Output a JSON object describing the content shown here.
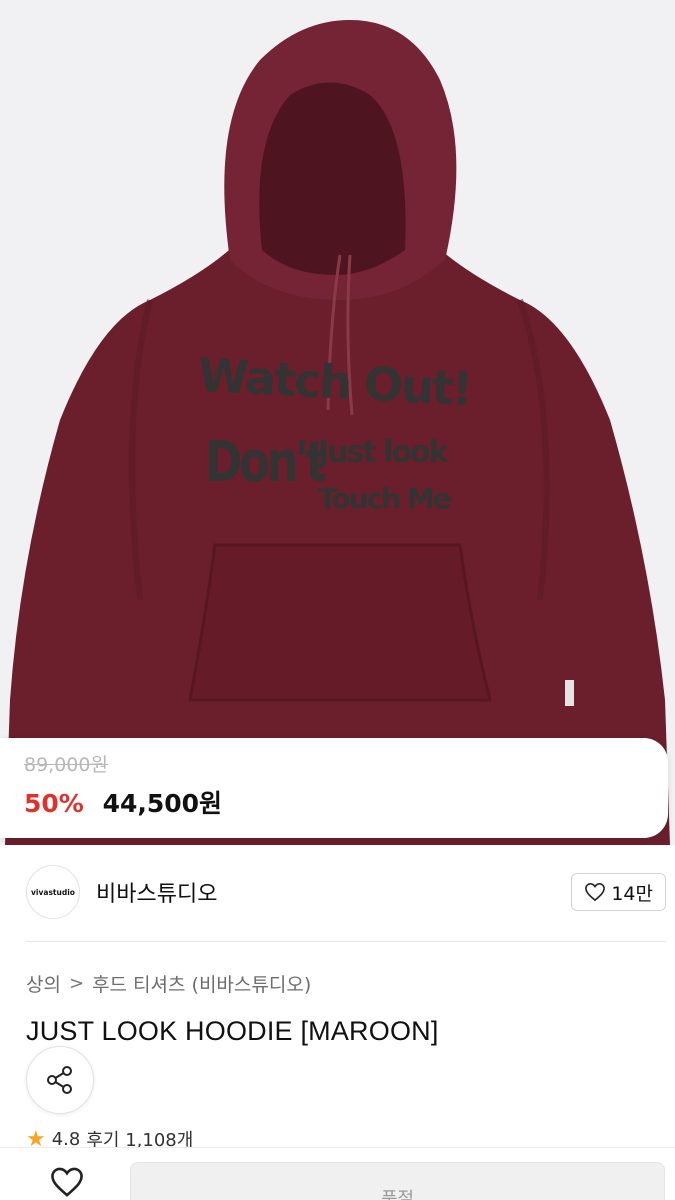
{
  "product": {
    "image_icon": "maroon-hoodie-photo",
    "print_lines": [
      "Watch Out!",
      "Don't",
      "Just look",
      "Touch Me"
    ],
    "colors": {
      "hoodie": "#6b1f2c",
      "print": "#333333",
      "accent_red": "#e0322c"
    }
  },
  "price": {
    "original": "89,000원",
    "discount": "50%",
    "sale": "44,500원"
  },
  "brand": {
    "logo_text": "vivastudio",
    "name": "비바스튜디오",
    "likes": "14만"
  },
  "breadcrumb": {
    "category": "상의",
    "separator": ">",
    "subcategory": "후드 티셔츠 (비바스튜디오)"
  },
  "title": "JUST LOOK HOODIE [MAROON]",
  "rating": {
    "score": "4.8",
    "reviews": "후기 1,108개"
  },
  "bottom": {
    "buy_label": "품절"
  }
}
